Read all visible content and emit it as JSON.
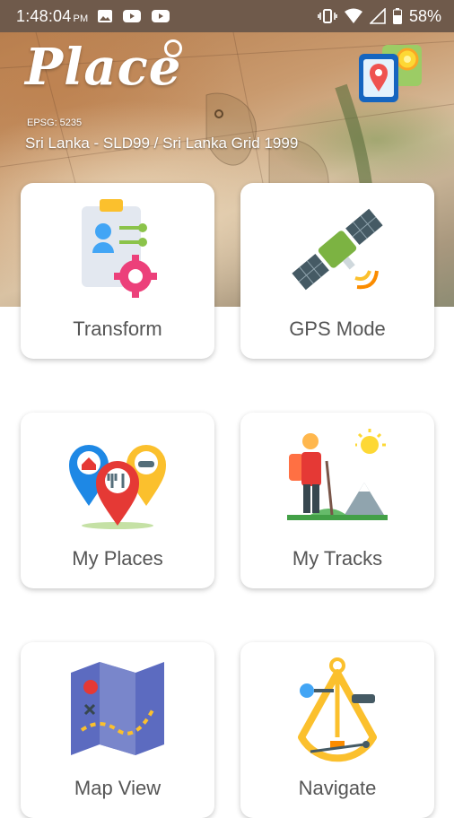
{
  "status_bar": {
    "time": "1:48:04",
    "ampm": "PM",
    "battery": "58%"
  },
  "header": {
    "app_name": "Place",
    "epsg": "EPSG: 5235",
    "crs_name": "Sri Lanka - SLD99 / Sri Lanka Grid 1999"
  },
  "tiles": [
    {
      "label": "Transform",
      "icon": "clipboard-gear-icon"
    },
    {
      "label": "GPS Mode",
      "icon": "satellite-icon"
    },
    {
      "label": "My Places",
      "icon": "map-pins-icon"
    },
    {
      "label": "My Tracks",
      "icon": "hiker-icon"
    },
    {
      "label": "Map View",
      "icon": "folded-map-icon"
    },
    {
      "label": "Navigate",
      "icon": "sextant-icon"
    }
  ],
  "colors": {
    "status_bar": "#6f5a4b",
    "card_label": "#555555",
    "card_background": "#ffffff"
  }
}
